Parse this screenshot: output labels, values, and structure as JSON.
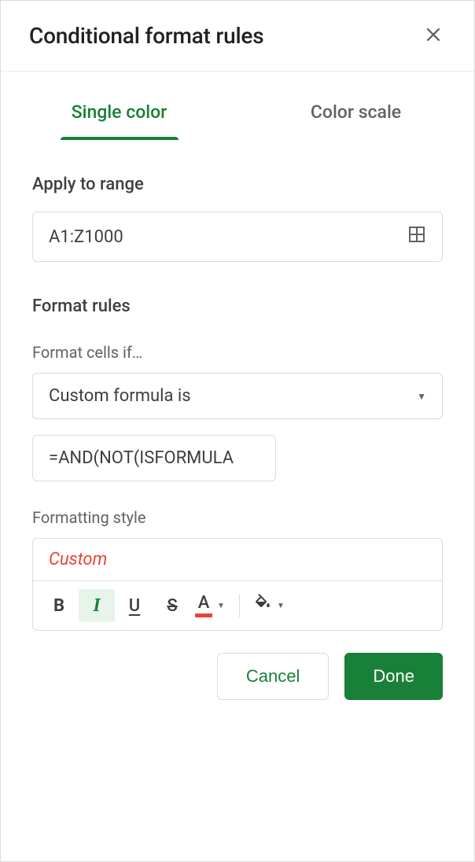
{
  "header": {
    "title": "Conditional format rules"
  },
  "tabs": {
    "single": "Single color",
    "scale": "Color scale"
  },
  "range": {
    "label": "Apply to range",
    "value": "A1:Z1000"
  },
  "rules": {
    "label": "Format rules",
    "condition_label": "Format cells if…",
    "condition_value": "Custom formula is",
    "formula": "=AND(NOT(ISFORMULA"
  },
  "style": {
    "label": "Formatting style",
    "preview": "Custom",
    "preview_color": "#ea4335",
    "preview_italic": true
  },
  "toolbar": {
    "bold": "B",
    "italic": "I",
    "underline": "U",
    "strike": "S",
    "textcolor": "A"
  },
  "footer": {
    "cancel": "Cancel",
    "done": "Done"
  }
}
